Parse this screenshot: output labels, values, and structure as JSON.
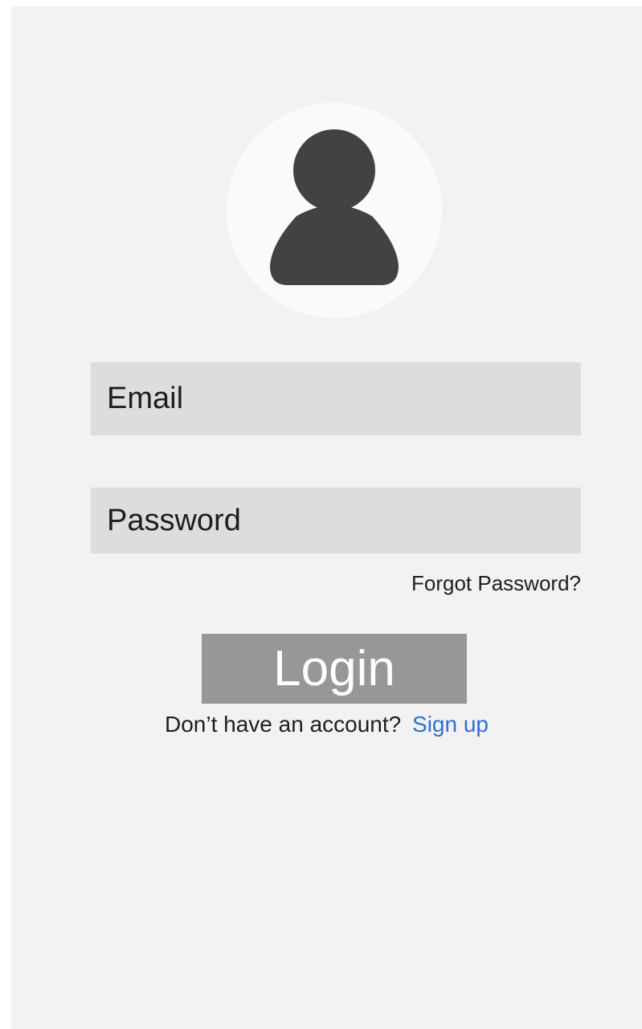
{
  "avatar": {
    "icon": "person-icon",
    "colors": {
      "circle": "#f9fafc",
      "figure": "#424242"
    }
  },
  "form": {
    "email_placeholder": "Email",
    "password_placeholder": "Password",
    "forgot_password_label": "Forgot Password?",
    "login_label": "Login",
    "no_account_text": "Don’t have an account?",
    "sign_up_label": "Sign up"
  },
  "colors": {
    "screen_background": "#f2f2f2",
    "input_background": "#dddddd",
    "button_background": "#979797",
    "link": "#2f6fd6"
  }
}
